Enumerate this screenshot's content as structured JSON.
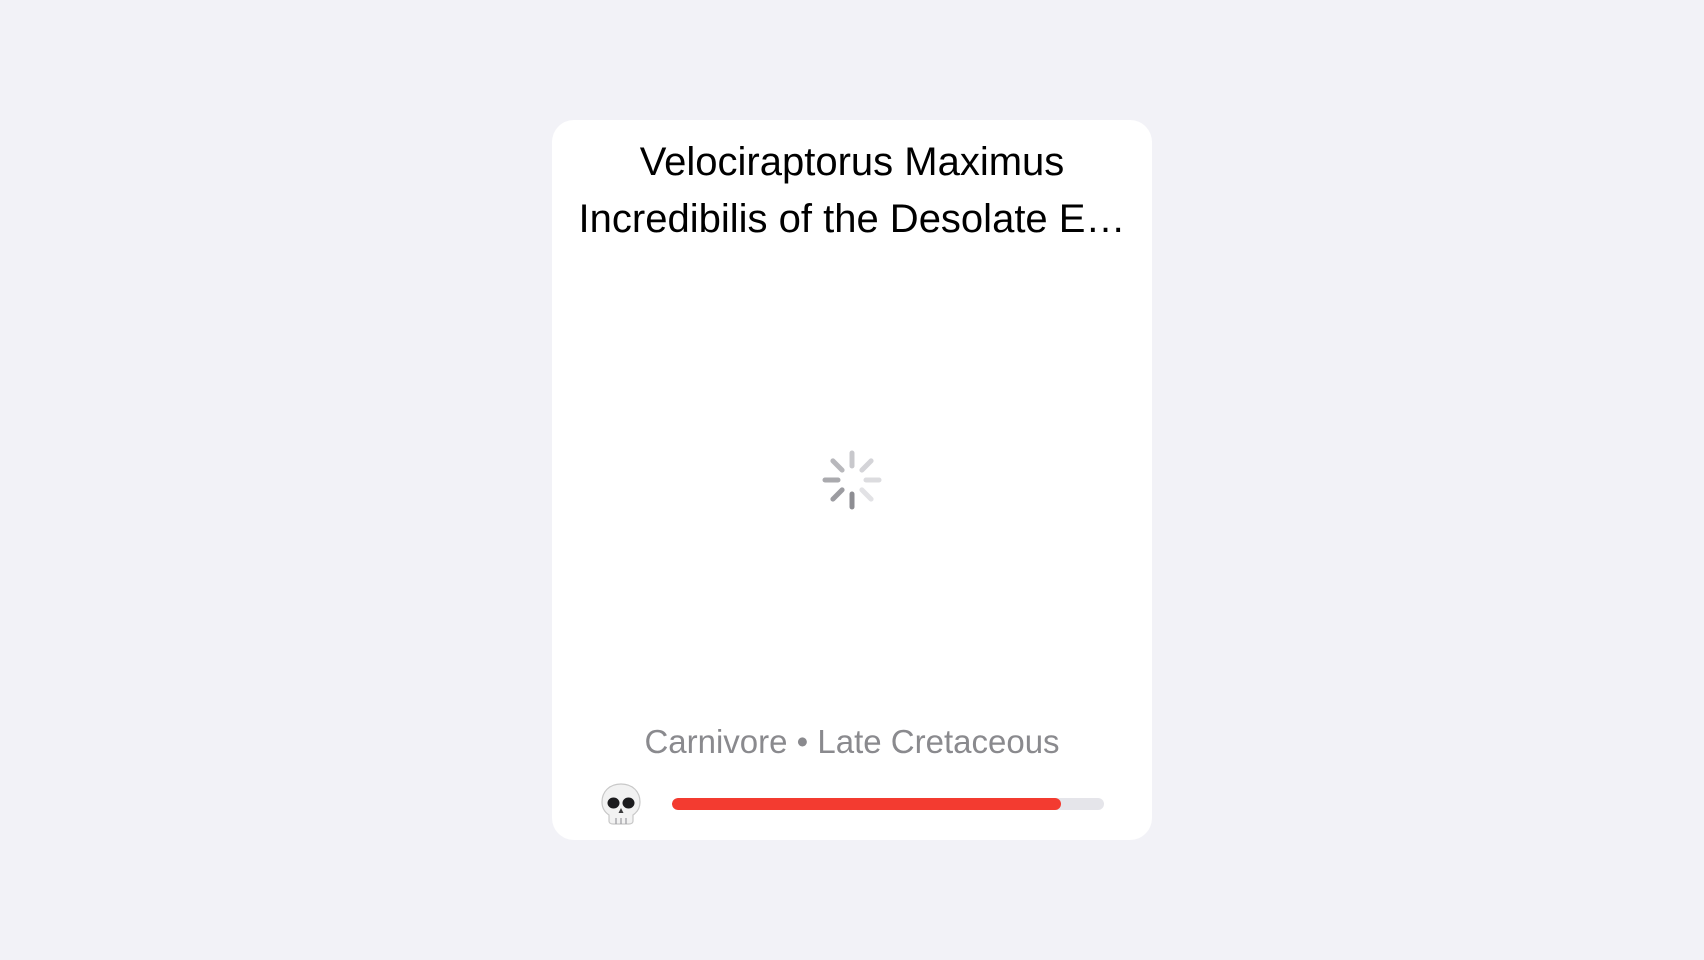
{
  "card": {
    "title_lines": [
      "Velociraptorus Maximus",
      "Incredibilis of the Desolate E…"
    ],
    "loading_icon": "activity-spinner-icon",
    "diet": "Carnivore",
    "separator": "•",
    "era": "Late Cretaceous",
    "status_icon": "skull-icon",
    "danger_level": 0.9,
    "colors": {
      "background": "#f2f2f7",
      "card": "#ffffff",
      "bar_fill": "#f33b30",
      "bar_track": "#e5e5ea",
      "secondary_text": "#8a8a8e"
    }
  }
}
